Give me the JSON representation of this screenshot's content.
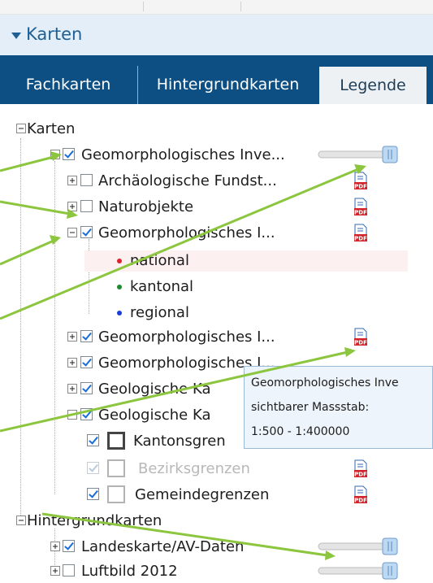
{
  "panel": {
    "title": "Karten"
  },
  "tabs": [
    {
      "label": "Fachkarten"
    },
    {
      "label": "Hintergrundkarten"
    },
    {
      "label": "Legende",
      "active": true
    }
  ],
  "tree": {
    "root_label": "Karten",
    "layer_geo_inv": "Geomorphologisches Inve...",
    "layer_archaeo": "Archäologische Fundst...",
    "layer_naturobjekte": "Naturobjekte",
    "layer_geo_1": "Geomorphologisches I...",
    "legend_national": "national",
    "legend_kantonal": "kantonal",
    "legend_regional": "regional",
    "layer_geo_2": "Geomorphologisches I...",
    "layer_geo_3": "Geomorphologisches I...",
    "layer_geol_1": "Geologische Ka",
    "layer_geol_2": "Geologische Ka",
    "layer_kantonsgrenzen": "Kantonsgren",
    "layer_bezirksgrenzen": "Bezirksgrenzen",
    "layer_gemeindegrenzen": "Gemeindegrenzen",
    "root2_label": "Hintergrundkarten",
    "layer_landeskarte": "Landeskarte/AV-Daten",
    "layer_luftbild": "Luftbild 2012"
  },
  "tooltip": {
    "line1": "Geomorphologisches Inve",
    "line2": "sichtbarer Massstab:",
    "line3": "1:500 - 1:400000"
  },
  "colors": {
    "header_bg": "#e3eef8",
    "tabbar_bg": "#0d4f82",
    "arrow": "#8cc63f",
    "pdf_red": "#d2232a",
    "dot_national": "#e0202a",
    "dot_kantonal": "#1e8a2e",
    "dot_regional": "#1a3fd8"
  },
  "icons": {
    "expand": "plus-box-icon",
    "collapse": "minus-box-icon",
    "pdf": "pdf-icon",
    "opacity_slider": "slider-icon"
  }
}
